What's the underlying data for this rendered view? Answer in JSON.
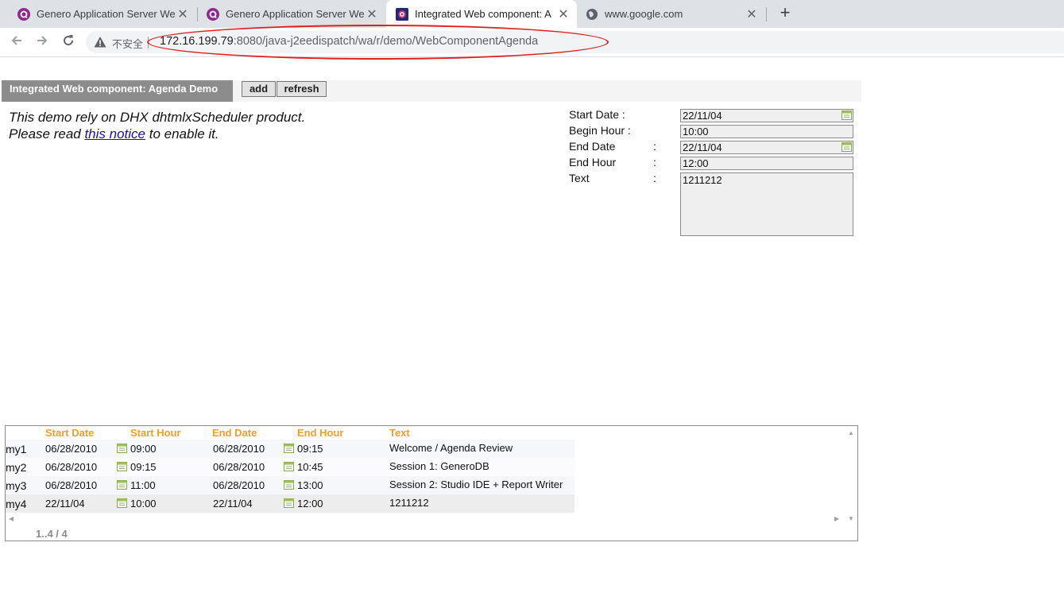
{
  "browser": {
    "tabs": [
      {
        "title": "Genero Application Server We",
        "close": "✕"
      },
      {
        "title": "Genero Application Server We",
        "close": "✕"
      },
      {
        "title": "Integrated Web component: A",
        "close": "✕"
      },
      {
        "title": "www.google.com",
        "close": "✕"
      }
    ],
    "new_tab": "+",
    "insecure_label": "不安全",
    "url_host": "172.16.199.79",
    "url_rest": ":8080/java-j2eedispatch/wa/r/demo/WebComponentAgenda"
  },
  "app": {
    "title": "Integrated Web component: Agenda Demo",
    "add_label": "add",
    "refresh_label": "refresh"
  },
  "notice": {
    "line1": "This demo rely on DHX dhtmlxScheduler product.",
    "line2_prefix": "Please read ",
    "link": "this notice",
    "line2_suffix": " to enable it."
  },
  "form": {
    "start_date_label": "Start Date :",
    "begin_hour_label": "Begin Hour :",
    "end_date_label": "End Date",
    "end_hour_label": "End Hour",
    "text_label": "Text",
    "colon": ":",
    "start_date": "22/11/04",
    "begin_hour": "10:00",
    "end_date": "22/11/04",
    "end_hour": "12:00",
    "text": "1211212"
  },
  "grid": {
    "headers": [
      "Start Date",
      "Start Hour",
      "End Date",
      "End Hour",
      "Text"
    ],
    "rows": [
      {
        "id": "my1",
        "start_date": "06/28/2010",
        "start_hour": "09:00",
        "end_date": "06/28/2010",
        "end_hour": "09:15",
        "text": "Welcome / Agenda Review"
      },
      {
        "id": "my2",
        "start_date": "06/28/2010",
        "start_hour": "09:15",
        "end_date": "06/28/2010",
        "end_hour": "10:45",
        "text": "Session 1: GeneroDB"
      },
      {
        "id": "my3",
        "start_date": "06/28/2010",
        "start_hour": "11:00",
        "end_date": "06/28/2010",
        "end_hour": "13:00",
        "text": "Session 2: Studio IDE + Report Writer"
      },
      {
        "id": "my4",
        "start_date": "22/11/04",
        "start_hour": "10:00",
        "end_date": "22/11/04",
        "end_hour": "12:00",
        "text": "1211212"
      }
    ],
    "pager": "1..4 / 4"
  },
  "colors": {
    "header_accent": "#f0a020",
    "annotation": "#e02020",
    "title_bg": "#8c8c8c"
  }
}
